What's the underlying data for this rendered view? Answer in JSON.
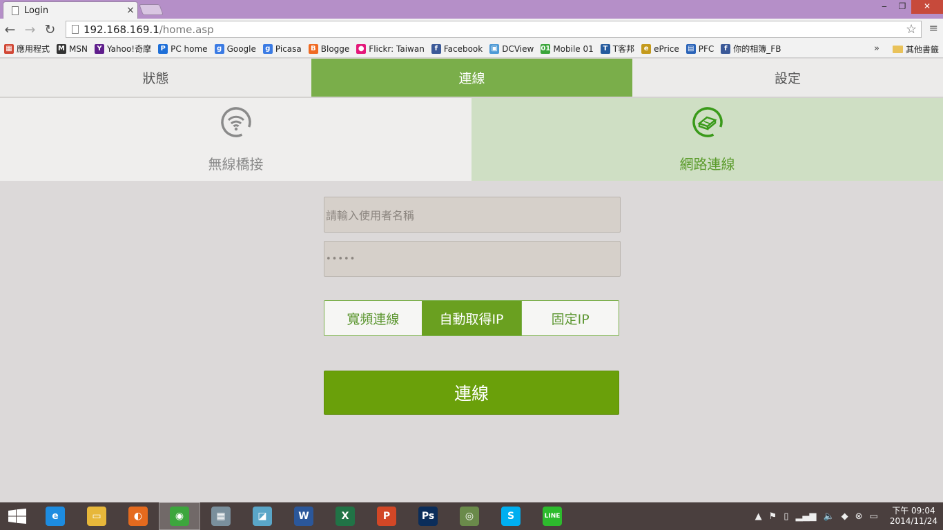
{
  "browser": {
    "tab_title": "Login",
    "tab_close": "×",
    "url_host": "192.168.169.1",
    "url_path": "/home.asp",
    "star": "☆",
    "menu": "≡",
    "win_min": "‒",
    "win_max": "❐",
    "win_close": "✕",
    "back": "←",
    "forward": "→",
    "reload": "↻"
  },
  "bookmarks": {
    "items": [
      {
        "label": "應用程式",
        "color": "#d14836",
        "glyph": "▦"
      },
      {
        "label": "MSN",
        "color": "#333333",
        "glyph": "M"
      },
      {
        "label": "Yahoo!奇摩",
        "color": "#5f1e8c",
        "glyph": "Y"
      },
      {
        "label": "PC home",
        "color": "#1e6fd8",
        "glyph": "P"
      },
      {
        "label": "Google",
        "color": "#3b7be4",
        "glyph": "g"
      },
      {
        "label": "Picasa",
        "color": "#3b7be4",
        "glyph": "g"
      },
      {
        "label": "Blogge",
        "color": "#f06a22",
        "glyph": "B"
      },
      {
        "label": "Flickr: Taiwan",
        "color": "#e4187a",
        "glyph": "●"
      },
      {
        "label": "Facebook",
        "color": "#3b5998",
        "glyph": "f"
      },
      {
        "label": "DCView",
        "color": "#4e9ad6",
        "glyph": "▣"
      },
      {
        "label": "Mobile 01",
        "color": "#3aa53a",
        "glyph": "01"
      },
      {
        "label": "T客邦",
        "color": "#245a9e",
        "glyph": "T"
      },
      {
        "label": "ePrice",
        "color": "#c49a1c",
        "glyph": "e"
      },
      {
        "label": "PFC",
        "color": "#2a63b8",
        "glyph": "▤"
      },
      {
        "label": "你的相簿_FB",
        "color": "#3b5998",
        "glyph": "f"
      }
    ],
    "chevron": "»",
    "other": "其他書籤"
  },
  "topnav": {
    "status": "狀態",
    "connect": "連線",
    "settings": "設定"
  },
  "subnav": {
    "wireless_bridge": "無線橋接",
    "network_connect": "網路連線"
  },
  "form": {
    "username_placeholder": "請輸入使用者名稱",
    "password_masked": "•••••",
    "segments": [
      "寬頻連線",
      "自動取得IP",
      "固定IP"
    ],
    "active_segment": "自動取得IP",
    "connect_button": "連線"
  },
  "taskbar": {
    "apps": [
      {
        "name": "ie",
        "glyph": "e",
        "color": "#1d8ce0"
      },
      {
        "name": "explorer",
        "glyph": "▭",
        "color": "#e7b73a"
      },
      {
        "name": "firefox",
        "glyph": "◐",
        "color": "#e56a1e"
      },
      {
        "name": "chrome",
        "glyph": "◉",
        "color": "#3da63d"
      },
      {
        "name": "calculator",
        "glyph": "▦",
        "color": "#7a8f9c"
      },
      {
        "name": "notes",
        "glyph": "◪",
        "color": "#5aa6c8"
      },
      {
        "name": "word",
        "glyph": "W",
        "color": "#2b579a"
      },
      {
        "name": "excel",
        "glyph": "X",
        "color": "#217346"
      },
      {
        "name": "powerpoint",
        "glyph": "P",
        "color": "#d24726"
      },
      {
        "name": "photoshop",
        "glyph": "Ps",
        "color": "#0b2d5a"
      },
      {
        "name": "app-swirl",
        "glyph": "◎",
        "color": "#6a8a4a"
      },
      {
        "name": "skype",
        "glyph": "S",
        "color": "#00aff0"
      },
      {
        "name": "line",
        "glyph": "LINE",
        "color": "#2dbb2d"
      }
    ],
    "time": "下午 09:04",
    "date": "2014/11/24"
  },
  "colors": {
    "accent_green": "#6aa00a",
    "nav_active": "#7aae4a"
  }
}
